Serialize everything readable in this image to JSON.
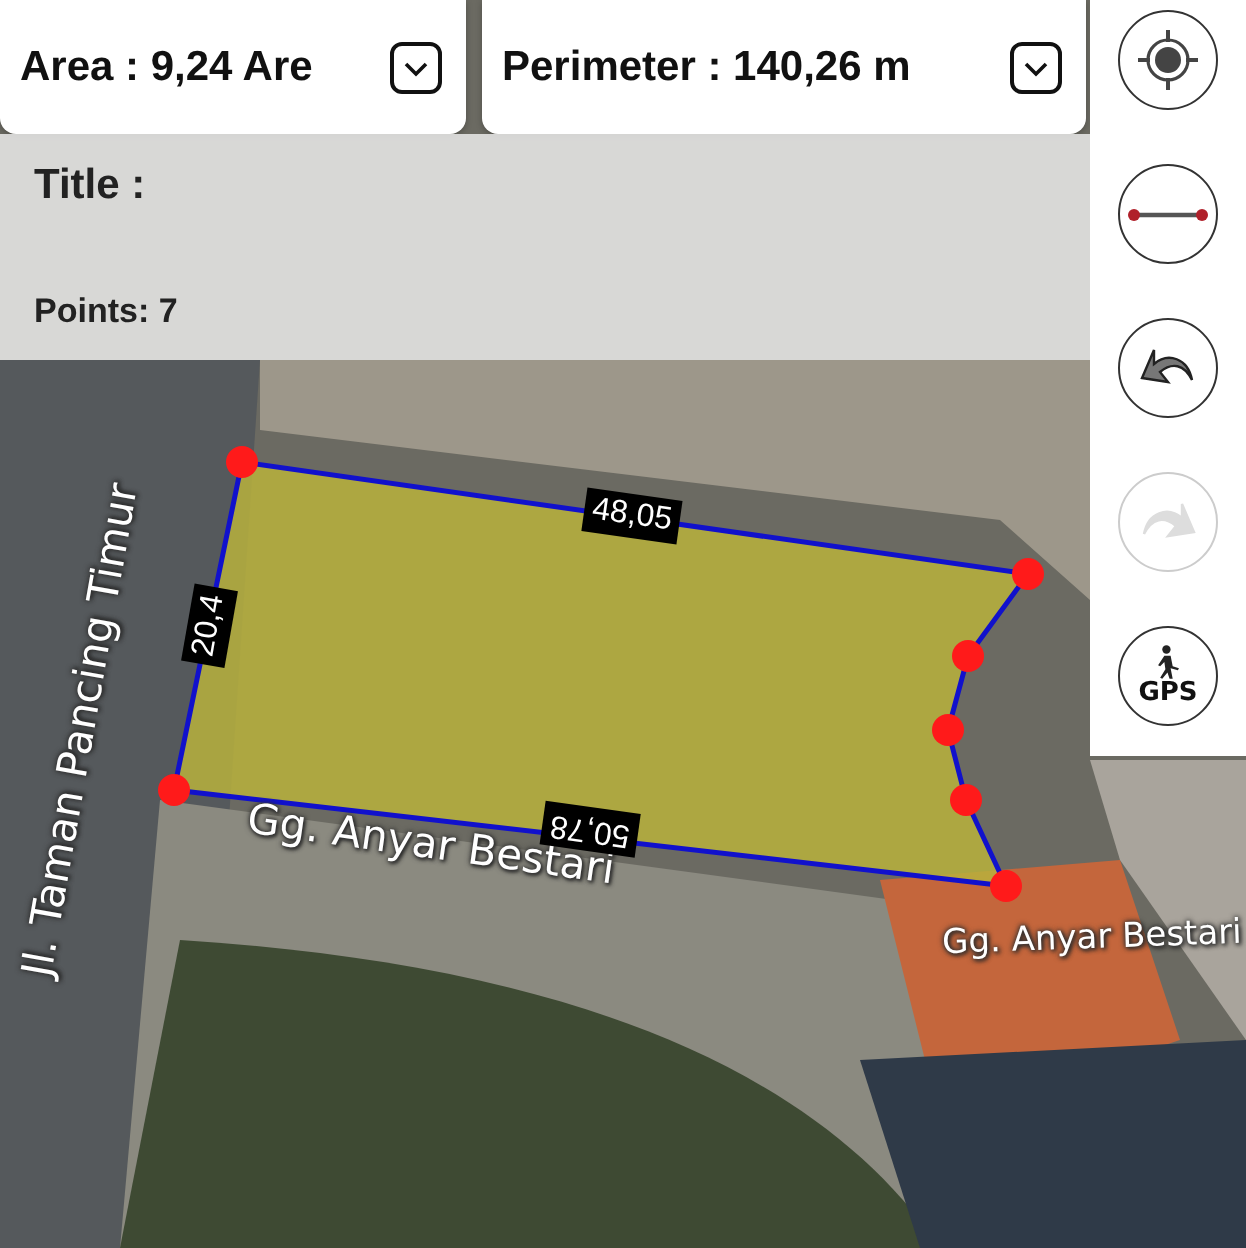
{
  "summary": [
    {
      "label": "Area : 9,24 Are"
    },
    {
      "label": "Perimeter : 140,26 m"
    }
  ],
  "info": {
    "title_label": "Title :",
    "points": "Points: 7"
  },
  "tools": [
    {
      "kind": "locate",
      "disabled": false
    },
    {
      "kind": "measure",
      "disabled": false
    },
    {
      "kind": "undo",
      "disabled": false
    },
    {
      "kind": "redo",
      "disabled": true
    },
    {
      "kind": "gps",
      "label": "GPS",
      "disabled": false
    }
  ],
  "map": {
    "street_labels": [
      "Jl. Taman Pancing Timur",
      "Gg. Anyar Bestari",
      "Gg. Anyar Bestari"
    ],
    "edge_labels": [
      "48,05",
      "20,4",
      "50,78"
    ]
  }
}
